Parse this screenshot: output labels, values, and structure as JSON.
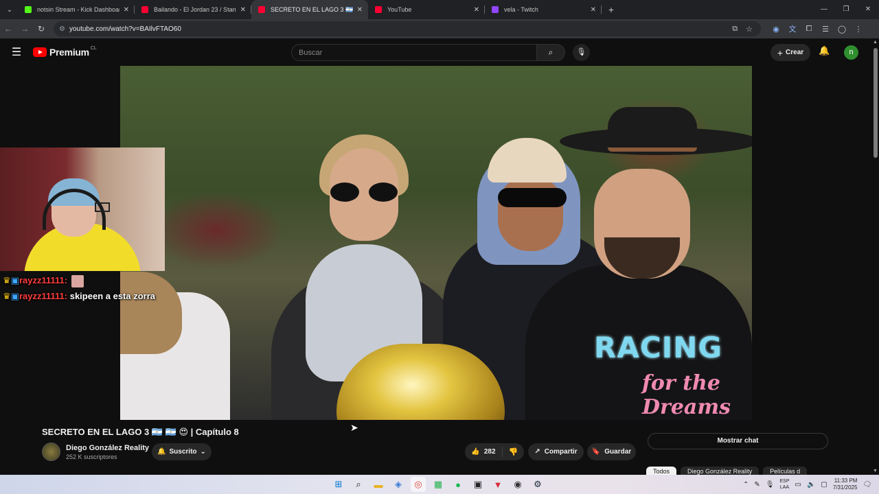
{
  "browser": {
    "tabs": [
      {
        "title": "notsin Stream - Kick Dashboard",
        "color": "#53fc18"
      },
      {
        "title": "Bailando - El Jordan 23 / Standi",
        "color": "#ff0033"
      },
      {
        "title": "SECRETO EN EL LAGO 3 🇦🇷 🔊",
        "color": "#ff0033",
        "active": true
      },
      {
        "title": "YouTube",
        "color": "#ff0033"
      },
      {
        "title": "vela - Twitch",
        "color": "#9146ff"
      }
    ],
    "url": "youtube.com/watch?v=BAIlvFTAO60"
  },
  "youtube": {
    "logo_text": "Premium",
    "country_code": "CL",
    "search_placeholder": "Buscar",
    "create_label": "Crear",
    "avatar_letter": "n"
  },
  "overlay": {
    "chat": [
      {
        "user": "rayzz11111:",
        "message": ""
      },
      {
        "user": "rayzz11111:",
        "message": "skipeen a esta zorra"
      }
    ]
  },
  "video_art": {
    "shirt_word": "RACING",
    "shirt_script": "for the Dreams"
  },
  "video": {
    "title": "SECRETO EN EL LAGO 3 🇦🇷 🇦🇷 😍 | Capítulo 8",
    "channel_name": "Diego González Reality",
    "subscribers": "252 K suscriptores",
    "subscribed_label": "Suscrito",
    "likes": "282",
    "share_label": "Compartir",
    "save_label": "Guardar",
    "show_chat_label": "Mostrar chat",
    "chips": [
      "Todos",
      "Diego González Reality",
      "Películas d"
    ]
  },
  "taskbar": {
    "lang_top": "ESP",
    "lang_bottom": "LAA",
    "time": "11:33 PM",
    "date": "7/31/2025"
  }
}
